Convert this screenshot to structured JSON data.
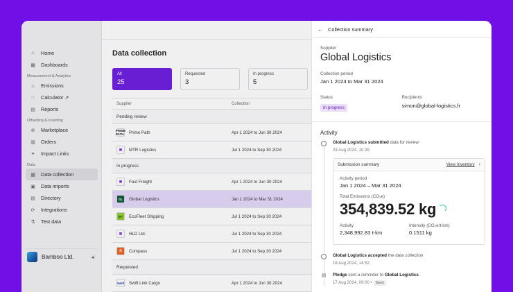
{
  "sidebar": {
    "items_top": [
      {
        "label": "Home",
        "icon": "home-icon",
        "glyph": "⌂"
      },
      {
        "label": "Dashboards",
        "icon": "dashboard-icon",
        "glyph": "▦"
      }
    ],
    "section_measurement": "Measurement & Analytics",
    "items_measurement": [
      {
        "label": "Emissions",
        "icon": "emissions-icon",
        "glyph": "♨"
      },
      {
        "label": "Calculator ↗",
        "icon": "calculator-icon",
        "glyph": "∷"
      },
      {
        "label": "Reports",
        "icon": "reports-icon",
        "glyph": "▤"
      }
    ],
    "section_offsetting": "Offsetting & Insetting",
    "items_offsetting": [
      {
        "label": "Marketplace",
        "icon": "marketplace-icon",
        "glyph": "⊕"
      },
      {
        "label": "Orders",
        "icon": "orders-icon",
        "glyph": "▥"
      },
      {
        "label": "Impact Links",
        "icon": "link-icon",
        "glyph": "⚭"
      }
    ],
    "section_data": "Data",
    "items_data": [
      {
        "label": "Data collection",
        "icon": "data-collection-icon",
        "glyph": "▦"
      },
      {
        "label": "Data imports",
        "icon": "data-imports-icon",
        "glyph": "▣"
      },
      {
        "label": "Directory",
        "icon": "directory-icon",
        "glyph": "▤"
      },
      {
        "label": "Integrations",
        "icon": "integrations-icon",
        "glyph": "⟳"
      },
      {
        "label": "Test data",
        "icon": "test-data-icon",
        "glyph": "⚗"
      }
    ],
    "org_name": "Bamboo Ltd."
  },
  "main": {
    "title": "Data collection",
    "cards": [
      {
        "label": "All",
        "count": "25"
      },
      {
        "label": "Requested",
        "count": "3"
      },
      {
        "label": "In progress",
        "count": "5"
      }
    ],
    "columns": [
      "Supplier",
      "Collection"
    ],
    "groups": [
      {
        "name": "Pending review",
        "rows": [
          {
            "supplier": "Prime Path",
            "period": "Apr 1 2024 to Jun 30 2024",
            "logo_text": "PRIME PATH",
            "logo_color": "#ffffff",
            "logo_fg": "#222222"
          },
          {
            "supplier": "MTR Logistics",
            "period": "Jul 1 2024 to Sep 30 2024",
            "logo_text": "▦",
            "logo_color": "#ffffff",
            "logo_fg": "#7b2fe0"
          }
        ]
      },
      {
        "name": "In progress",
        "rows": [
          {
            "supplier": "Fast Freight",
            "period": "Apr 1 2024 to Jun 30 2024",
            "logo_text": "▦",
            "logo_color": "#ffffff",
            "logo_fg": "#7b2fe0"
          },
          {
            "supplier": "Global Logistics",
            "period": "Jan 1 2024 to Mar 31 2024",
            "logo_text": "GL",
            "logo_color": "#0f5a3a",
            "logo_fg": "#ffffff"
          },
          {
            "supplier": "EcoFleet Shipping",
            "period": "Jul 1 2024 to Sep 30 2024",
            "logo_text": "EF",
            "logo_color": "#8ecf2a",
            "logo_fg": "#1d4a10"
          },
          {
            "supplier": "HLD Ltd.",
            "period": "Jul 1 2024 to Sep 30 2024",
            "logo_text": "▦",
            "logo_color": "#ffffff",
            "logo_fg": "#7b2fe0"
          },
          {
            "supplier": "Compass",
            "period": "Jul 1 2024 to Sep 30 2024",
            "logo_text": "☰",
            "logo_color": "#f0641e",
            "logo_fg": "#ffffff"
          }
        ]
      },
      {
        "name": "Requested",
        "rows": [
          {
            "supplier": "Swift Link Cargo",
            "period": "Apr 1 2024 to Jun 30 2024",
            "logo_text": "Swift",
            "logo_color": "#ffffff",
            "logo_fg": "#1a3fa0"
          }
        ]
      }
    ]
  },
  "panel": {
    "header": "Collection summary",
    "supplier_label": "Supplier",
    "supplier_name": "Global Logistics",
    "period_label": "Collection period",
    "period_value": "Jan 1 2024 to Mar 31 2024",
    "status_label": "Status",
    "status_value": "In progress",
    "recipients_label": "Recipients",
    "recipients_value": "simon@global-logistics.fr",
    "activity_title": "Activity",
    "events": {
      "e1_bold": "Global Logistics submitted",
      "e1_rest": " data for review",
      "e1_time": "23 Aug 2024, 10:39",
      "e2_bold": "Global Logistics accepted",
      "e2_rest": " the data collection",
      "e2_time": "18 Aug 2024, 14:52",
      "e3_bold1": "Pledge",
      "e3_mid": " sent a reminder to ",
      "e3_bold2": "Global Logistics",
      "e3_time": "17 Aug 2024, 09:00 •",
      "e3_badge": "Seen"
    },
    "submission": {
      "title": "Submission summary",
      "view_link": "View inventory",
      "activity_period_label": "Activity period",
      "activity_period_value": "Jan 1 2024 – Mar 31 2024",
      "total_label": "Total Emissions (CO₂e)",
      "total_value": "354,839.52 kg",
      "activity_label": "Activity",
      "activity_value": "2,348,992.83 t-km",
      "intensity_label": "Intensity (CO₂e/t-km)",
      "intensity_value": "0.1511 kg"
    }
  },
  "colors": {
    "background": "#7010e6",
    "accent": "#6d1fdf",
    "selected_row": "#e6d9fa",
    "status_pill": "#ecdcfc",
    "spinner": "#2bd0a8"
  }
}
